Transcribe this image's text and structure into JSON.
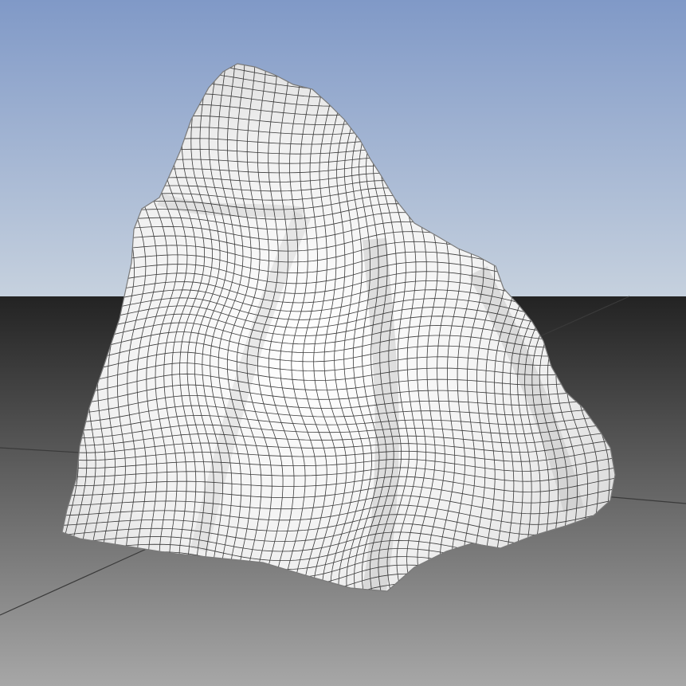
{
  "scene": {
    "subject": "rock-mesh",
    "colors": {
      "sky_top": "#8099c7",
      "sky_bottom": "#c6d1de",
      "ground_top": "#232323",
      "ground_bottom": "#a7a7a7",
      "mesh_fill": "#f2f2f2",
      "mesh_shadow": "#bdbdbd",
      "wire": "#1a1a1a",
      "grid_line": "#3a3a3a"
    }
  }
}
